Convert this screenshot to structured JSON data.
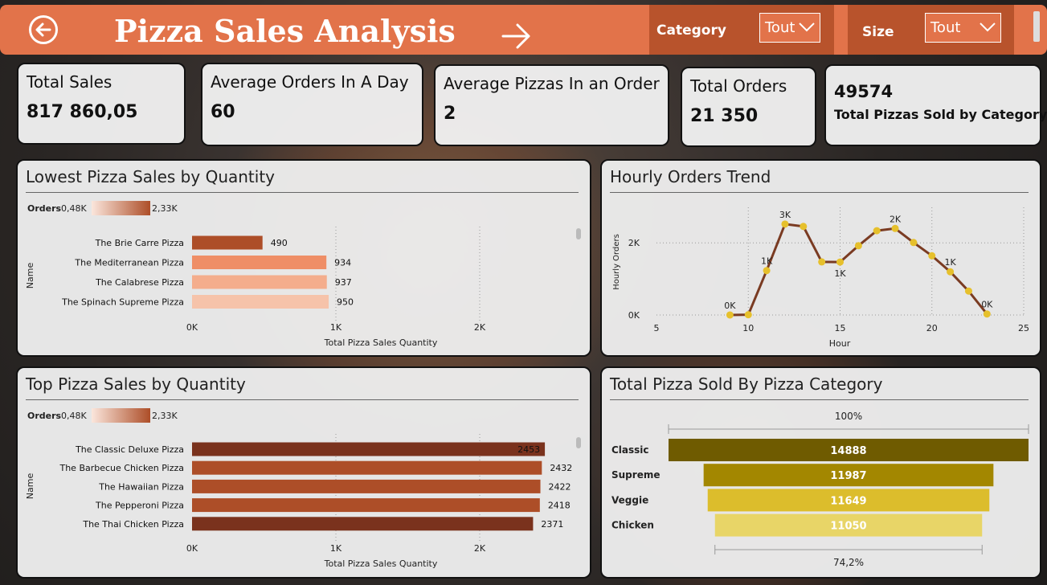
{
  "header": {
    "title": "Pizza Sales Analysis",
    "category_label": "Category",
    "category_value": "Tout",
    "size_label": "Size",
    "size_value": "Tout"
  },
  "kpis": [
    {
      "label": "Total Sales",
      "value": "817 860,05"
    },
    {
      "label": "Average Orders In A Day",
      "value": "60"
    },
    {
      "label": "Average Pizzas In an Order",
      "value": "2"
    },
    {
      "label": "Total Orders",
      "value": "21 350"
    },
    {
      "label": "Total Pizzas Sold by Category",
      "value": "49574"
    }
  ],
  "colors": {
    "header": "#e2734a",
    "slicer_bg": "#b8532c",
    "line": "#7a3b22",
    "marker": "#e6c02c"
  },
  "chart_data": [
    {
      "type": "bar",
      "title": "Lowest Pizza Sales by Quantity",
      "legend": {
        "label": "Orders",
        "min": "0,48K",
        "max": "2,33K"
      },
      "categories": [
        "The Brie Carre Pizza",
        "The Mediterranean Pizza",
        "The Calabrese Pizza",
        "The Spinach Supreme Pizza"
      ],
      "values": [
        490,
        934,
        937,
        950
      ],
      "colors": [
        "#ad4e28",
        "#ef8e66",
        "#f4ad8c",
        "#f6c3aa"
      ],
      "xlabel": "Total Pizza Sales Quantity",
      "ylabel": "Name",
      "xlim": [
        0,
        2500
      ],
      "xticks": [
        {
          "v": 0,
          "label": "0K"
        },
        {
          "v": 1000,
          "label": "1K"
        },
        {
          "v": 2000,
          "label": "2K"
        }
      ]
    },
    {
      "type": "line",
      "title": "Hourly Orders Trend",
      "x": [
        9,
        10,
        11,
        12,
        13,
        14,
        15,
        16,
        17,
        18,
        19,
        20,
        21,
        22,
        23
      ],
      "y": [
        1,
        8,
        1231,
        2520,
        2455,
        1472,
        1468,
        1920,
        2336,
        2399,
        2009,
        1642,
        1198,
        663,
        28
      ],
      "data_labels": [
        {
          "x": 9,
          "label": "0K"
        },
        {
          "x": 11,
          "label": "1K"
        },
        {
          "x": 12,
          "label": "3K"
        },
        {
          "x": 15,
          "label": "1K"
        },
        {
          "x": 18,
          "label": "2K"
        },
        {
          "x": 21,
          "label": "1K"
        },
        {
          "x": 23,
          "label": "0K"
        }
      ],
      "xlabel": "Hour",
      "ylabel": "Hourly Orders",
      "xlim": [
        5,
        25
      ],
      "ylim": [
        0,
        3000
      ],
      "xticks": [
        5,
        10,
        15,
        20,
        25
      ],
      "yticks": [
        {
          "v": 0,
          "label": "0K"
        },
        {
          "v": 2000,
          "label": "2K"
        }
      ]
    },
    {
      "type": "bar",
      "title": "Top Pizza Sales by Quantity",
      "legend": {
        "label": "Orders",
        "min": "0,48K",
        "max": "2,33K"
      },
      "categories": [
        "The Classic Deluxe Pizza",
        "The Barbecue Chicken Pizza",
        "The Hawaiian Pizza",
        "The Pepperoni Pizza",
        "The Thai Chicken Pizza"
      ],
      "values": [
        2453,
        2432,
        2422,
        2418,
        2371
      ],
      "colors": [
        "#7a321d",
        "#ad4e28",
        "#ad4e28",
        "#ad4e28",
        "#7a321d"
      ],
      "xlabel": "Total Pizza Sales Quantity",
      "ylabel": "Name",
      "xlim": [
        0,
        2500
      ],
      "xticks": [
        {
          "v": 0,
          "label": "0K"
        },
        {
          "v": 1000,
          "label": "1K"
        },
        {
          "v": 2000,
          "label": "2K"
        }
      ]
    },
    {
      "type": "bar",
      "subtype": "funnel",
      "title": "Total Pizza Sold By Pizza Category",
      "categories": [
        "Classic",
        "Supreme",
        "Veggie",
        "Chicken"
      ],
      "values": [
        14888,
        11987,
        11649,
        11050
      ],
      "colors": [
        "#6f5b00",
        "#a38700",
        "#dcbd2c",
        "#e8d567"
      ],
      "top_label": "100%",
      "bottom_label": "74,2%"
    }
  ]
}
